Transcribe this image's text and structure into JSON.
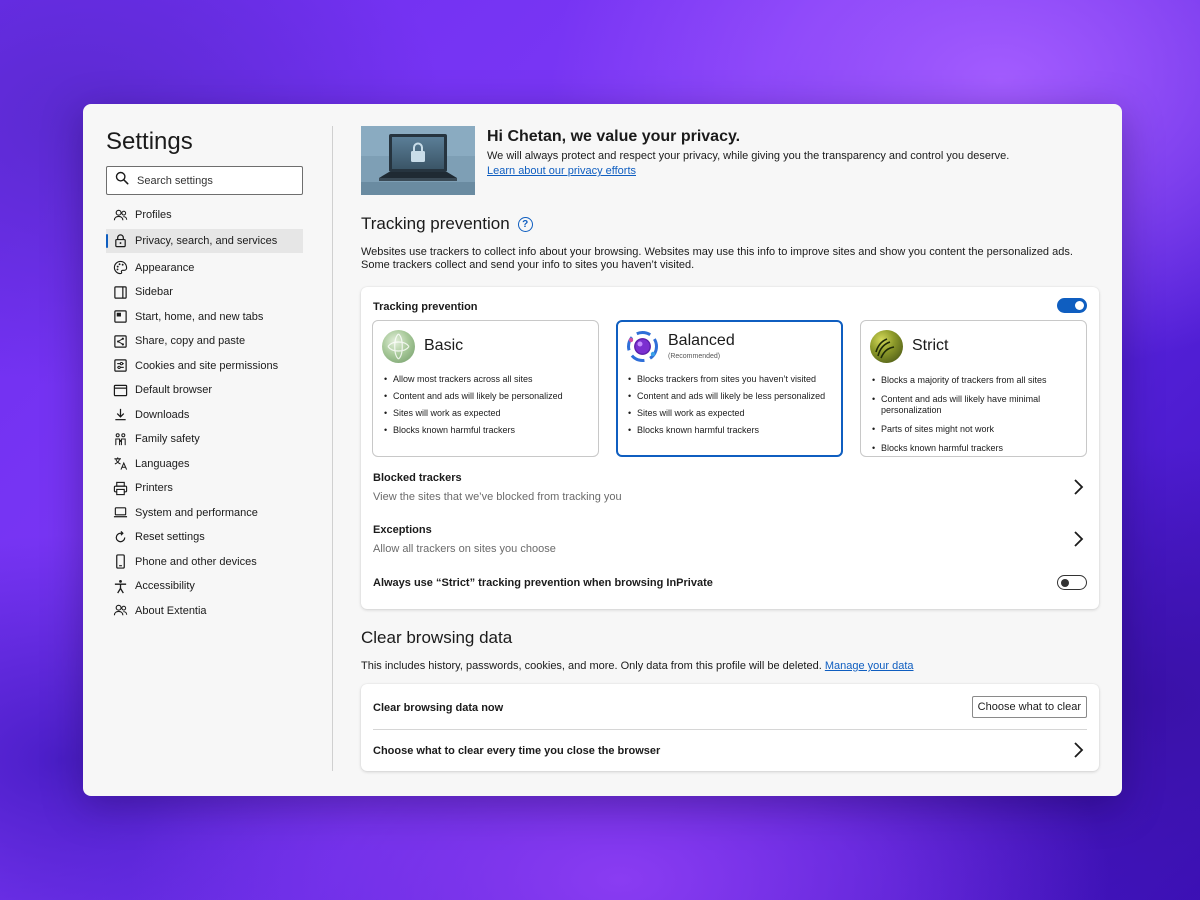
{
  "sidebar": {
    "title": "Settings",
    "search_placeholder": "Search settings",
    "items": [
      {
        "label": "Profiles",
        "icon": "profiles-icon"
      },
      {
        "label": "Privacy, search, and services",
        "icon": "lock-icon",
        "active": true
      },
      {
        "label": "Appearance",
        "icon": "palette-icon"
      },
      {
        "label": "Sidebar",
        "icon": "sidebar-icon"
      },
      {
        "label": "Start, home, and new tabs",
        "icon": "home-tabs-icon"
      },
      {
        "label": "Share, copy and paste",
        "icon": "share-icon"
      },
      {
        "label": "Cookies and site permissions",
        "icon": "cookies-icon"
      },
      {
        "label": "Default browser",
        "icon": "browser-icon"
      },
      {
        "label": "Downloads",
        "icon": "download-icon"
      },
      {
        "label": "Family safety",
        "icon": "family-icon"
      },
      {
        "label": "Languages",
        "icon": "languages-icon"
      },
      {
        "label": "Printers",
        "icon": "printer-icon"
      },
      {
        "label": "System and performance",
        "icon": "laptop-icon"
      },
      {
        "label": "Reset settings",
        "icon": "reset-icon"
      },
      {
        "label": "Phone and other devices",
        "icon": "phone-icon"
      },
      {
        "label": "Accessibility",
        "icon": "accessibility-icon"
      },
      {
        "label": "About Extentia",
        "icon": "about-icon"
      }
    ]
  },
  "hero": {
    "title": "Hi Chetan, we value your privacy.",
    "text": "We will always protect and respect your privacy, while giving you the transparency and control you deserve.",
    "link": "Learn about our privacy efforts"
  },
  "tracking": {
    "title": "Tracking prevention",
    "description": "Websites use trackers to collect info about your browsing. Websites may use this info to improve sites and show you content the personalized ads. Some trackers collect and send your info to sites you haven’t visited.",
    "card_label": "Tracking prevention",
    "enabled": true,
    "levels": [
      {
        "name": "Basic",
        "sub": "",
        "selected": false,
        "icon": "basic-icon",
        "bullets": [
          "Allow most trackers across all sites",
          "Content and ads will likely be personalized",
          "Sites will work as expected",
          "Blocks known harmful trackers"
        ]
      },
      {
        "name": "Balanced",
        "sub": "(Recommended)",
        "selected": true,
        "icon": "balanced-icon",
        "bullets": [
          "Blocks trackers from sites you haven’t visited",
          "Content and ads will likely be less personalized",
          "Sites will work as expected",
          "Blocks known harmful trackers"
        ]
      },
      {
        "name": "Strict",
        "sub": "",
        "selected": false,
        "icon": "strict-icon",
        "bullets": [
          "Blocks a majority of trackers from all sites",
          "Content and ads will likely have minimal personalization",
          "Parts of sites might not work",
          "Blocks known harmful trackers"
        ]
      }
    ],
    "blocked_title": "Blocked trackers",
    "blocked_sub": "View the sites that we’ve blocked from tracking you",
    "exceptions_title": "Exceptions",
    "exceptions_sub": "Allow all trackers on sites you choose",
    "strict_inprivate": "Always use “Strict” tracking prevention when browsing InPrivate",
    "strict_inprivate_enabled": false
  },
  "clear": {
    "title": "Clear browsing data",
    "description": "This includes history, passwords, cookies, and more. Only data from this profile will be deleted.",
    "manage_link": "Manage your data",
    "now_label": "Clear browsing data now",
    "button": "Choose what to clear",
    "on_close_label": "Choose what to clear every time you close the browser"
  },
  "colors": {
    "accent": "#0f5ec0",
    "window_bg": "#f7f7f7",
    "background": "#6d2df0"
  }
}
